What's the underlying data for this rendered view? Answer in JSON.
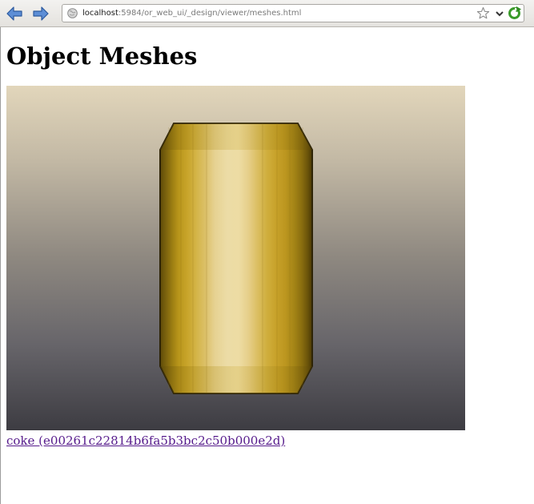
{
  "browser": {
    "url_host": "localhost",
    "url_path": ":5984/or_web_ui/_design/viewer/meshes.html",
    "icons": {
      "back": "back-arrow-icon",
      "forward": "forward-arrow-icon",
      "site": "globe-icon",
      "bookmark": "star-icon",
      "history": "chevron-down-icon",
      "reload": "reload-icon"
    },
    "accent": "#2a6fbf"
  },
  "page": {
    "title": "Object Meshes",
    "meshes": [
      {
        "link_text": "coke (e00261c22814b6fa5b3bc2c50b000e2d)"
      }
    ],
    "link_color": "#551a8b"
  }
}
